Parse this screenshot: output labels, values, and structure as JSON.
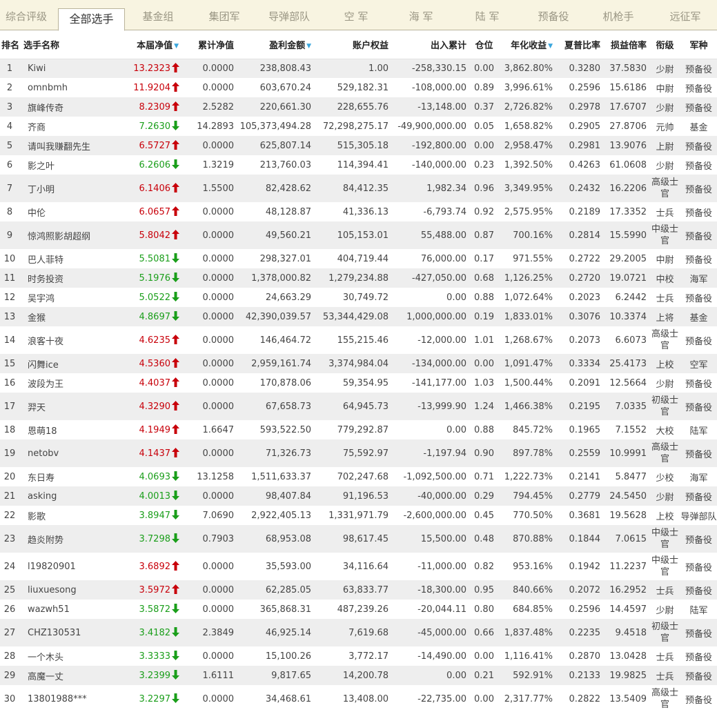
{
  "tabs": [
    {
      "label": "综合评级"
    },
    {
      "label": "全部选手"
    },
    {
      "label": "基金组"
    },
    {
      "label": "集团军"
    },
    {
      "label": "导弹部队"
    },
    {
      "label": "空 军"
    },
    {
      "label": "海 军"
    },
    {
      "label": "陆 军"
    },
    {
      "label": "预备役"
    },
    {
      "label": "机枪手"
    },
    {
      "label": "远征军"
    }
  ],
  "active_tab": "全部选手",
  "columns": {
    "rank": "排名",
    "name": "选手名称",
    "nav": "本届净值",
    "cum_nav": "累计净值",
    "profit": "盈利金额",
    "equity": "账户权益",
    "flow": "出入累计",
    "position": "仓位",
    "annual": "年化收益",
    "sharpe": "夏普比率",
    "pl_ratio": "损益倍率",
    "title": "衔级",
    "branch": "军种"
  },
  "sort_indicator": "▼",
  "colors": {
    "up": "#c8000a",
    "down": "#1a9e1a",
    "sort": "#3aa6dd",
    "tab_bar": "#f8f4e1"
  },
  "rows": [
    {
      "rank": "1",
      "name": "Kiwi",
      "nav": "13.2323",
      "trend": "up",
      "cum_nav": "0.0000",
      "profit": "238,808.43",
      "equity": "1.00",
      "flow": "-258,330.15",
      "position": "0.00",
      "annual": "3,862.80%",
      "sharpe": "0.3280",
      "pl_ratio": "37.5830",
      "title": "少尉",
      "branch": "预备役"
    },
    {
      "rank": "2",
      "name": "omnbmh",
      "nav": "11.9204",
      "trend": "up",
      "cum_nav": "0.0000",
      "profit": "603,670.24",
      "equity": "529,182.31",
      "flow": "-108,000.00",
      "position": "0.89",
      "annual": "3,996.61%",
      "sharpe": "0.2596",
      "pl_ratio": "15.6186",
      "title": "中尉",
      "branch": "预备役"
    },
    {
      "rank": "3",
      "name": "旗峰传奇",
      "nav": "8.2309",
      "trend": "up",
      "cum_nav": "2.5282",
      "profit": "220,661.30",
      "equity": "228,655.76",
      "flow": "-13,148.00",
      "position": "0.37",
      "annual": "2,726.82%",
      "sharpe": "0.2978",
      "pl_ratio": "17.6707",
      "title": "少尉",
      "branch": "预备役"
    },
    {
      "rank": "4",
      "name": "齐商",
      "nav": "7.2630",
      "trend": "down",
      "cum_nav": "14.2893",
      "profit": "105,373,494.28",
      "equity": "72,298,275.17",
      "flow": "-49,900,000.00",
      "position": "0.05",
      "annual": "1,658.82%",
      "sharpe": "0.2905",
      "pl_ratio": "27.8706",
      "title": "元帅",
      "branch": "基金"
    },
    {
      "rank": "5",
      "name": "请叫我赚翻先生",
      "nav": "6.5727",
      "trend": "up",
      "cum_nav": "0.0000",
      "profit": "625,807.14",
      "equity": "515,305.18",
      "flow": "-192,800.00",
      "position": "0.00",
      "annual": "2,958.47%",
      "sharpe": "0.2981",
      "pl_ratio": "13.9076",
      "title": "上尉",
      "branch": "预备役"
    },
    {
      "rank": "6",
      "name": "影之叶",
      "nav": "6.2606",
      "trend": "down",
      "cum_nav": "1.3219",
      "profit": "213,760.03",
      "equity": "114,394.41",
      "flow": "-140,000.00",
      "position": "0.23",
      "annual": "1,392.50%",
      "sharpe": "0.4263",
      "pl_ratio": "61.0608",
      "title": "少尉",
      "branch": "预备役"
    },
    {
      "rank": "7",
      "name": "丁小明",
      "nav": "6.1406",
      "trend": "up",
      "cum_nav": "1.5500",
      "profit": "82,428.62",
      "equity": "84,412.35",
      "flow": "1,982.34",
      "position": "0.96",
      "annual": "3,349.95%",
      "sharpe": "0.2432",
      "pl_ratio": "16.2206",
      "title": "高级士官",
      "branch": "预备役"
    },
    {
      "rank": "8",
      "name": "中伦",
      "nav": "6.0657",
      "trend": "up",
      "cum_nav": "0.0000",
      "profit": "48,128.87",
      "equity": "41,336.13",
      "flow": "-6,793.74",
      "position": "0.92",
      "annual": "2,575.95%",
      "sharpe": "0.2189",
      "pl_ratio": "17.3352",
      "title": "士兵",
      "branch": "预备役"
    },
    {
      "rank": "9",
      "name": "惊鸿照影胡超纲",
      "nav": "5.8042",
      "trend": "up",
      "cum_nav": "0.0000",
      "profit": "49,560.21",
      "equity": "105,153.01",
      "flow": "55,488.00",
      "position": "0.87",
      "annual": "700.16%",
      "sharpe": "0.2814",
      "pl_ratio": "15.5990",
      "title": "中级士官",
      "branch": "预备役"
    },
    {
      "rank": "10",
      "name": "巴人菲特",
      "nav": "5.5081",
      "trend": "down",
      "cum_nav": "0.0000",
      "profit": "298,327.01",
      "equity": "404,719.44",
      "flow": "76,000.00",
      "position": "0.17",
      "annual": "971.55%",
      "sharpe": "0.2722",
      "pl_ratio": "29.2005",
      "title": "中尉",
      "branch": "预备役"
    },
    {
      "rank": "11",
      "name": "时务投资",
      "nav": "5.1976",
      "trend": "down",
      "cum_nav": "0.0000",
      "profit": "1,378,000.82",
      "equity": "1,279,234.88",
      "flow": "-427,050.00",
      "position": "0.68",
      "annual": "1,126.25%",
      "sharpe": "0.2720",
      "pl_ratio": "19.0721",
      "title": "中校",
      "branch": "海军"
    },
    {
      "rank": "12",
      "name": "吴宇鸿",
      "nav": "5.0522",
      "trend": "down",
      "cum_nav": "0.0000",
      "profit": "24,663.29",
      "equity": "30,749.72",
      "flow": "0.00",
      "position": "0.88",
      "annual": "1,072.64%",
      "sharpe": "0.2023",
      "pl_ratio": "6.2442",
      "title": "士兵",
      "branch": "预备役"
    },
    {
      "rank": "13",
      "name": "金猴",
      "nav": "4.8697",
      "trend": "down",
      "cum_nav": "0.0000",
      "profit": "42,390,039.57",
      "equity": "53,344,429.08",
      "flow": "1,000,000.00",
      "position": "0.19",
      "annual": "1,833.01%",
      "sharpe": "0.3076",
      "pl_ratio": "10.3374",
      "title": "上将",
      "branch": "基金"
    },
    {
      "rank": "14",
      "name": "浪客十夜",
      "nav": "4.6235",
      "trend": "up",
      "cum_nav": "0.0000",
      "profit": "146,464.72",
      "equity": "155,215.46",
      "flow": "-12,000.00",
      "position": "1.01",
      "annual": "1,268.67%",
      "sharpe": "0.2073",
      "pl_ratio": "6.6073",
      "title": "高级士官",
      "branch": "预备役"
    },
    {
      "rank": "15",
      "name": "闪舞ice",
      "nav": "4.5360",
      "trend": "up",
      "cum_nav": "0.0000",
      "profit": "2,959,161.74",
      "equity": "3,374,984.04",
      "flow": "-134,000.00",
      "position": "0.00",
      "annual": "1,091.47%",
      "sharpe": "0.3334",
      "pl_ratio": "25.4173",
      "title": "上校",
      "branch": "空军"
    },
    {
      "rank": "16",
      "name": "波段为王",
      "nav": "4.4037",
      "trend": "up",
      "cum_nav": "0.0000",
      "profit": "170,878.06",
      "equity": "59,354.95",
      "flow": "-141,177.00",
      "position": "1.03",
      "annual": "1,500.44%",
      "sharpe": "0.2091",
      "pl_ratio": "12.5664",
      "title": "少尉",
      "branch": "预备役"
    },
    {
      "rank": "17",
      "name": "羿天",
      "nav": "4.3290",
      "trend": "up",
      "cum_nav": "0.0000",
      "profit": "67,658.73",
      "equity": "64,945.73",
      "flow": "-13,999.90",
      "position": "1.24",
      "annual": "1,466.38%",
      "sharpe": "0.2195",
      "pl_ratio": "7.0335",
      "title": "初级士官",
      "branch": "预备役"
    },
    {
      "rank": "18",
      "name": "恩萌18",
      "nav": "4.1949",
      "trend": "up",
      "cum_nav": "1.6647",
      "profit": "593,522.50",
      "equity": "779,292.87",
      "flow": "0.00",
      "position": "0.88",
      "annual": "845.72%",
      "sharpe": "0.1965",
      "pl_ratio": "7.1552",
      "title": "大校",
      "branch": "陆军"
    },
    {
      "rank": "19",
      "name": "netobv",
      "nav": "4.1437",
      "trend": "up",
      "cum_nav": "0.0000",
      "profit": "71,326.73",
      "equity": "75,592.97",
      "flow": "-1,197.94",
      "position": "0.90",
      "annual": "897.78%",
      "sharpe": "0.2559",
      "pl_ratio": "10.9991",
      "title": "高级士官",
      "branch": "预备役"
    },
    {
      "rank": "20",
      "name": "东日寿",
      "nav": "4.0693",
      "trend": "down",
      "cum_nav": "13.1258",
      "profit": "1,511,633.37",
      "equity": "702,247.68",
      "flow": "-1,092,500.00",
      "position": "0.71",
      "annual": "1,222.73%",
      "sharpe": "0.2141",
      "pl_ratio": "5.8477",
      "title": "少校",
      "branch": "海军"
    },
    {
      "rank": "21",
      "name": "asking",
      "nav": "4.0013",
      "trend": "down",
      "cum_nav": "0.0000",
      "profit": "98,407.84",
      "equity": "91,196.53",
      "flow": "-40,000.00",
      "position": "0.29",
      "annual": "794.45%",
      "sharpe": "0.2779",
      "pl_ratio": "24.5450",
      "title": "少尉",
      "branch": "预备役"
    },
    {
      "rank": "22",
      "name": "影歌",
      "nav": "3.8947",
      "trend": "down",
      "cum_nav": "7.0690",
      "profit": "2,922,405.13",
      "equity": "1,331,971.79",
      "flow": "-2,600,000.00",
      "position": "0.45",
      "annual": "770.50%",
      "sharpe": "0.3681",
      "pl_ratio": "19.5628",
      "title": "上校",
      "branch": "导弹部队"
    },
    {
      "rank": "23",
      "name": "趋炎附势",
      "nav": "3.7298",
      "trend": "down",
      "cum_nav": "0.7903",
      "profit": "68,953.08",
      "equity": "98,617.45",
      "flow": "15,500.00",
      "position": "0.48",
      "annual": "870.88%",
      "sharpe": "0.1844",
      "pl_ratio": "7.0615",
      "title": "中级士官",
      "branch": "预备役"
    },
    {
      "rank": "24",
      "name": "l19820901",
      "nav": "3.6892",
      "trend": "up",
      "cum_nav": "0.0000",
      "profit": "35,593.00",
      "equity": "34,116.64",
      "flow": "-11,000.00",
      "position": "0.82",
      "annual": "953.16%",
      "sharpe": "0.1942",
      "pl_ratio": "11.2237",
      "title": "中级士官",
      "branch": "预备役"
    },
    {
      "rank": "25",
      "name": "liuxuesong",
      "nav": "3.5972",
      "trend": "up",
      "cum_nav": "0.0000",
      "profit": "62,285.05",
      "equity": "63,833.77",
      "flow": "-18,300.00",
      "position": "0.95",
      "annual": "840.66%",
      "sharpe": "0.2072",
      "pl_ratio": "16.2952",
      "title": "士兵",
      "branch": "预备役"
    },
    {
      "rank": "26",
      "name": "wazwh51",
      "nav": "3.5872",
      "trend": "down",
      "cum_nav": "0.0000",
      "profit": "365,868.31",
      "equity": "487,239.26",
      "flow": "-20,044.11",
      "position": "0.80",
      "annual": "684.85%",
      "sharpe": "0.2596",
      "pl_ratio": "14.4597",
      "title": "少尉",
      "branch": "陆军"
    },
    {
      "rank": "27",
      "name": "CHZ130531",
      "nav": "3.4182",
      "trend": "down",
      "cum_nav": "2.3849",
      "profit": "46,925.14",
      "equity": "7,619.68",
      "flow": "-45,000.00",
      "position": "0.66",
      "annual": "1,837.48%",
      "sharpe": "0.2235",
      "pl_ratio": "9.4518",
      "title": "初级士官",
      "branch": "预备役"
    },
    {
      "rank": "28",
      "name": "一个木头",
      "nav": "3.3333",
      "trend": "down",
      "cum_nav": "0.0000",
      "profit": "15,100.26",
      "equity": "3,772.17",
      "flow": "-14,490.00",
      "position": "0.00",
      "annual": "1,116.41%",
      "sharpe": "0.2870",
      "pl_ratio": "13.0428",
      "title": "士兵",
      "branch": "预备役"
    },
    {
      "rank": "29",
      "name": "高魔一丈",
      "nav": "3.2399",
      "trend": "down",
      "cum_nav": "1.6111",
      "profit": "9,817.65",
      "equity": "14,200.78",
      "flow": "0.00",
      "position": "0.21",
      "annual": "592.91%",
      "sharpe": "0.2133",
      "pl_ratio": "19.9825",
      "title": "士兵",
      "branch": "预备役"
    },
    {
      "rank": "30",
      "name": "13801988***",
      "nav": "3.2297",
      "trend": "down",
      "cum_nav": "0.0000",
      "profit": "34,468.61",
      "equity": "13,408.00",
      "flow": "-22,735.00",
      "position": "0.00",
      "annual": "2,317.77%",
      "sharpe": "0.2822",
      "pl_ratio": "13.5409",
      "title": "高级士官",
      "branch": "预备役"
    }
  ]
}
